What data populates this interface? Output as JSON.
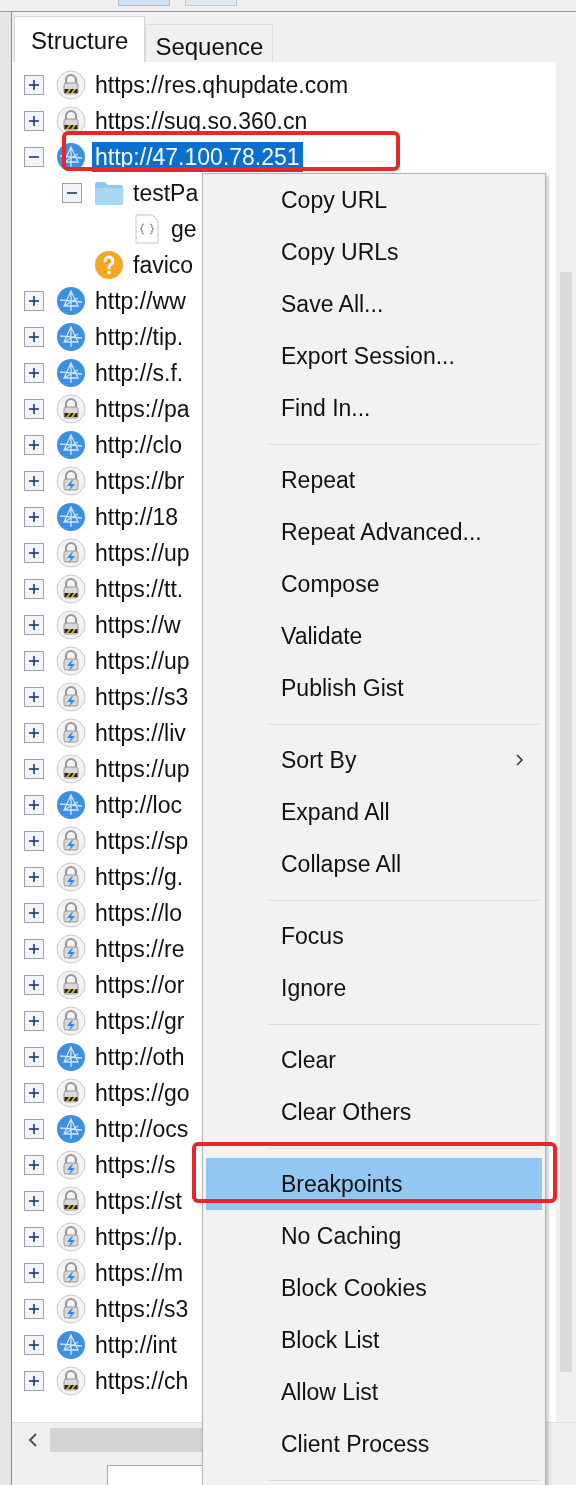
{
  "tabs": [
    {
      "label": "Structure",
      "selected": true
    },
    {
      "label": "Sequence",
      "selected": false
    }
  ],
  "tree": [
    {
      "label": "https://res.qhupdate.com",
      "kind": "lock",
      "expanded": false,
      "selected": false
    },
    {
      "label": "https://sug.so.360.cn",
      "kind": "lock",
      "expanded": false,
      "selected": false
    },
    {
      "label": "http://47.100.78.251",
      "kind": "globe",
      "expanded": true,
      "selected": true,
      "children": [
        {
          "label": "testPa",
          "kind": "folder",
          "expanded": true,
          "selected": false,
          "children": [
            {
              "label": "ge",
              "kind": "file",
              "selected": false
            }
          ]
        },
        {
          "label": "favico",
          "kind": "unknown",
          "selected": false
        }
      ]
    },
    {
      "label": "http://ww",
      "kind": "globe",
      "expanded": false,
      "selected": false
    },
    {
      "label": "http://tip.",
      "kind": "globe",
      "expanded": false,
      "selected": false
    },
    {
      "label": "http://s.f.",
      "kind": "globe",
      "expanded": false,
      "selected": false
    },
    {
      "label": "https://pa",
      "kind": "lock",
      "expanded": false,
      "selected": false
    },
    {
      "label": "http://clo",
      "kind": "globe",
      "expanded": false,
      "selected": false
    },
    {
      "label": "https://br",
      "kind": "bolt",
      "expanded": false,
      "selected": false
    },
    {
      "label": "http://18",
      "kind": "globe",
      "expanded": false,
      "selected": false
    },
    {
      "label": "https://up",
      "kind": "bolt",
      "expanded": false,
      "selected": false
    },
    {
      "label": "https://tt.",
      "kind": "lock",
      "expanded": false,
      "selected": false
    },
    {
      "label": "https://w",
      "kind": "lock",
      "expanded": false,
      "selected": false
    },
    {
      "label": "https://up",
      "kind": "bolt",
      "expanded": false,
      "selected": false
    },
    {
      "label": "https://s3",
      "kind": "bolt",
      "expanded": false,
      "selected": false
    },
    {
      "label": "https://liv",
      "kind": "bolt",
      "expanded": false,
      "selected": false
    },
    {
      "label": "https://up",
      "kind": "lock",
      "expanded": false,
      "selected": false
    },
    {
      "label": "http://loc",
      "kind": "globe",
      "expanded": false,
      "selected": false
    },
    {
      "label": "https://sp",
      "kind": "bolt",
      "expanded": false,
      "selected": false
    },
    {
      "label": "https://g.",
      "kind": "bolt",
      "expanded": false,
      "selected": false
    },
    {
      "label": "https://lo",
      "kind": "bolt",
      "expanded": false,
      "selected": false
    },
    {
      "label": "https://re",
      "kind": "bolt",
      "expanded": false,
      "selected": false
    },
    {
      "label": "https://or",
      "kind": "lock",
      "expanded": false,
      "selected": false
    },
    {
      "label": "https://gr",
      "kind": "bolt",
      "expanded": false,
      "selected": false
    },
    {
      "label": "http://oth",
      "kind": "globe",
      "expanded": false,
      "selected": false
    },
    {
      "label": "https://go",
      "kind": "lock",
      "expanded": false,
      "selected": false
    },
    {
      "label": "http://ocs",
      "kind": "globe",
      "expanded": false,
      "selected": false
    },
    {
      "label": "https://s",
      "kind": "bolt",
      "expanded": false,
      "selected": false
    },
    {
      "label": "https://st",
      "kind": "lock",
      "expanded": false,
      "selected": false
    },
    {
      "label": "https://p.",
      "kind": "bolt",
      "expanded": false,
      "selected": false
    },
    {
      "label": "https://m",
      "kind": "bolt",
      "expanded": false,
      "selected": false
    },
    {
      "label": "https://s3",
      "kind": "bolt",
      "expanded": false,
      "selected": false
    },
    {
      "label": "http://int",
      "kind": "globe",
      "expanded": false,
      "selected": false
    },
    {
      "label": "https://ch",
      "kind": "lock",
      "expanded": false,
      "selected": false
    }
  ],
  "context_menu": {
    "groups": [
      [
        {
          "label": "Copy URL",
          "kind": "action",
          "selected": false
        },
        {
          "label": "Copy URLs",
          "kind": "action",
          "selected": false
        },
        {
          "label": "Save All...",
          "kind": "action",
          "selected": false
        },
        {
          "label": "Export Session...",
          "kind": "action",
          "selected": false
        },
        {
          "label": "Find In...",
          "kind": "action",
          "selected": false
        }
      ],
      [
        {
          "label": "Repeat",
          "kind": "action",
          "selected": false
        },
        {
          "label": "Repeat Advanced...",
          "kind": "action",
          "selected": false
        },
        {
          "label": "Compose",
          "kind": "action",
          "selected": false
        },
        {
          "label": "Validate",
          "kind": "action",
          "selected": false
        },
        {
          "label": "Publish Gist",
          "kind": "action",
          "selected": false
        }
      ],
      [
        {
          "label": "Sort By",
          "kind": "submenu",
          "selected": false
        },
        {
          "label": "Expand All",
          "kind": "action",
          "selected": false
        },
        {
          "label": "Collapse All",
          "kind": "action",
          "selected": false
        }
      ],
      [
        {
          "label": "Focus",
          "kind": "action",
          "selected": false
        },
        {
          "label": "Ignore",
          "kind": "action",
          "selected": false
        }
      ],
      [
        {
          "label": "Clear",
          "kind": "action",
          "selected": false
        },
        {
          "label": "Clear Others",
          "kind": "action",
          "selected": false
        }
      ],
      [
        {
          "label": "Breakpoints",
          "kind": "action",
          "selected": true
        },
        {
          "label": "No Caching",
          "kind": "action",
          "selected": false
        },
        {
          "label": "Block Cookies",
          "kind": "action",
          "selected": false
        },
        {
          "label": "Block List",
          "kind": "action",
          "selected": false
        },
        {
          "label": "Allow List",
          "kind": "action",
          "selected": false
        },
        {
          "label": "Client Process",
          "kind": "action",
          "selected": false
        }
      ]
    ]
  }
}
